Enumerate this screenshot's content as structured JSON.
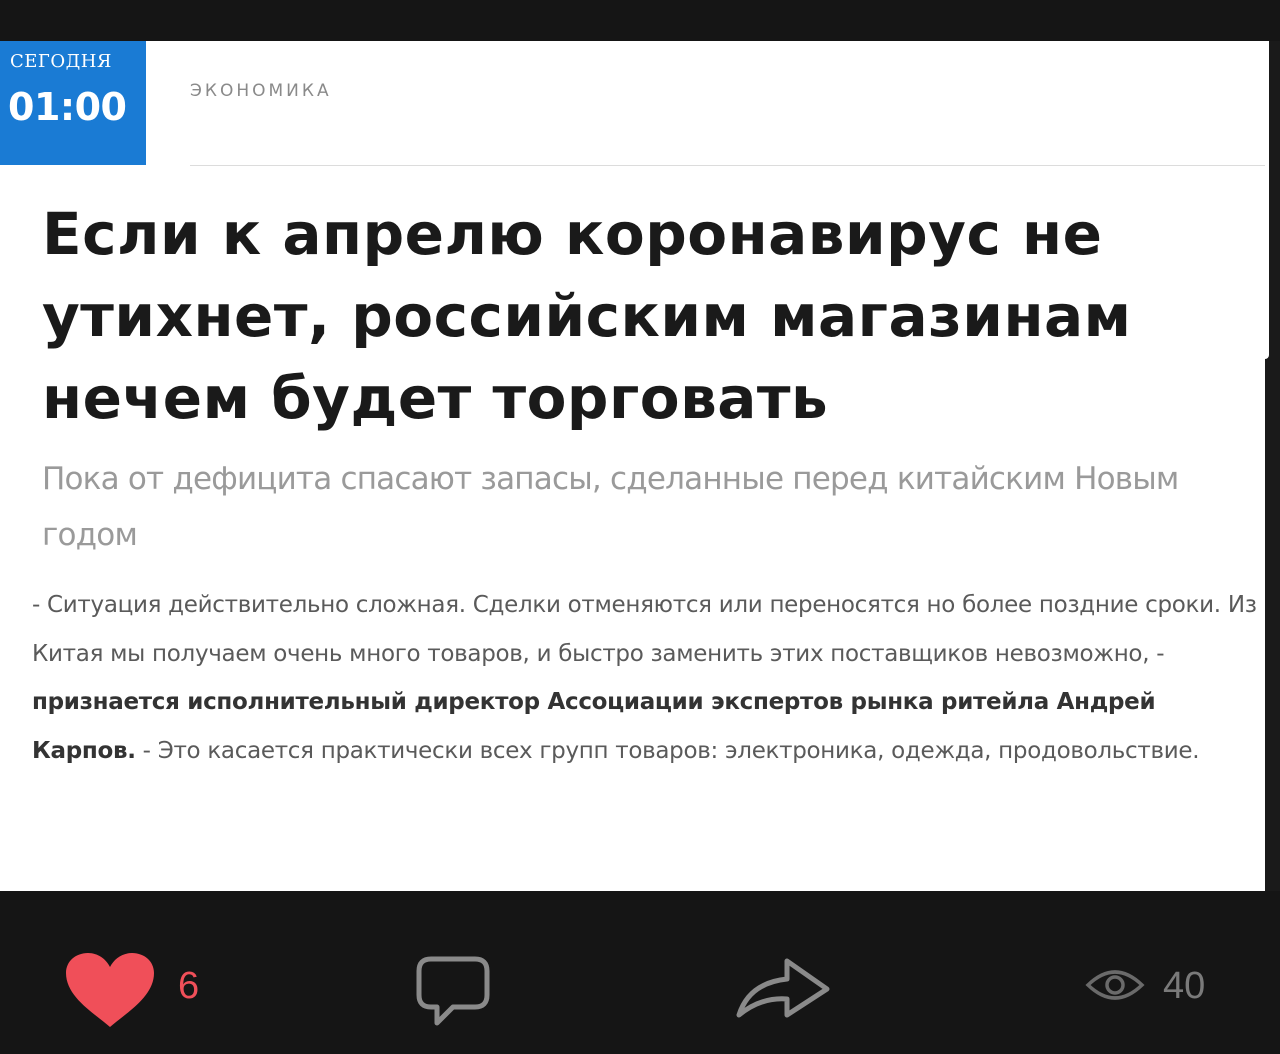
{
  "badge": {
    "label": "СЕГОДНЯ",
    "time": "01:00"
  },
  "category": "ЭКОНОМИКА",
  "headline": "Если к апрелю коронавирус не утихнет, российским магазинам нечем будет торговать",
  "lead": "Пока от дефицита спасают запасы, сделанные перед китайским Новым годом",
  "body": {
    "part1": "- Ситуация действительно сложная. Сделки отменяются или переносятся но более поздние сроки. Из Китая мы получаем очень много товаров, и быстро заменить этих поставщиков невозможно, - ",
    "bold": "признается исполнительный директор Ассоциации экспертов рынка ритейла Андрей Карпов.",
    "part2": " - Это касается практически всех групп товаров: электроника, одежда, продовольствие."
  },
  "actions": {
    "like_count": "6",
    "views_count": "40",
    "icons": [
      "heart-icon",
      "comment-icon",
      "share-icon",
      "eye-icon"
    ],
    "colors": {
      "like": "#f04f59",
      "icon": "#8a8a8a",
      "badge": "#1a7bd4"
    }
  }
}
